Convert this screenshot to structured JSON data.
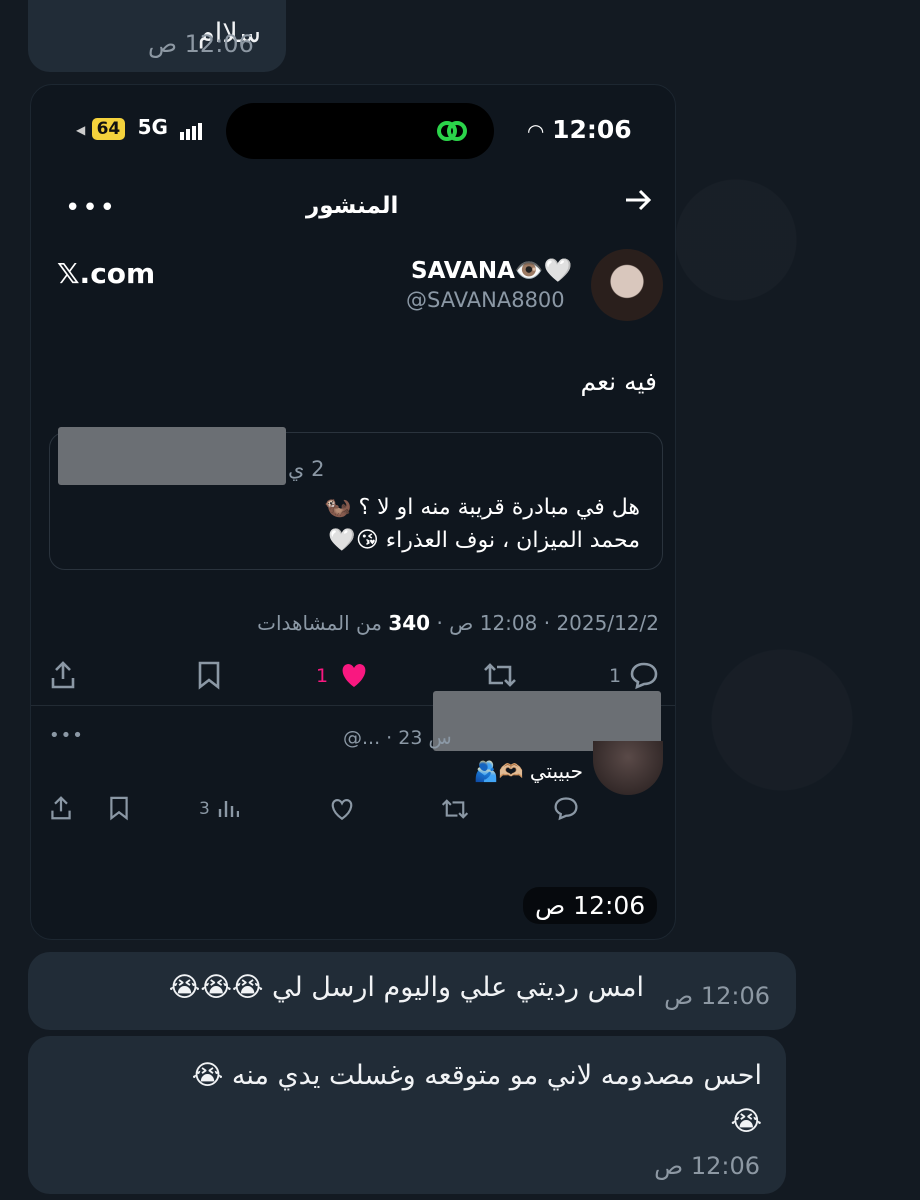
{
  "messages": [
    {
      "text": "سلاام",
      "time": "12:06 ص"
    },
    {
      "text": "امس رديتي علي واليوم ارسل لي 😭😭😭",
      "time": "12:06 ص"
    },
    {
      "text_line1": "احس مصدومه لاني مو متوقعه وغسلت يدي منه 😭",
      "text_line2": "😭",
      "time": "12:06 ص"
    }
  ],
  "image_message": {
    "time": "12:06 ص"
  },
  "screenshot": {
    "status_bar": {
      "battery": "64",
      "network": "5G",
      "time": "12:06"
    },
    "header": {
      "title": "المنشور"
    },
    "post": {
      "display_name": "SAVANA👁️🤍",
      "handle": "@SAVANA8800",
      "domain": "𝕏.com",
      "text": "فيه نعم",
      "quoted": {
        "meta": "2 ي",
        "line1": "هل في مبادرة قريبة منه او لا ؟ 🦦",
        "line2": "محمد الميزان ، نوف العذراء 😘🤍"
      },
      "meta_date": "2025/12/2",
      "meta_time": "12:08 ص",
      "views_count": "340",
      "views_label": "من المشاهدات",
      "replies": "1",
      "likes": "1"
    },
    "reply": {
      "meta": "@... · 23 س",
      "text": "حبيبتي 🫶🏼🫂",
      "views": "3"
    }
  }
}
